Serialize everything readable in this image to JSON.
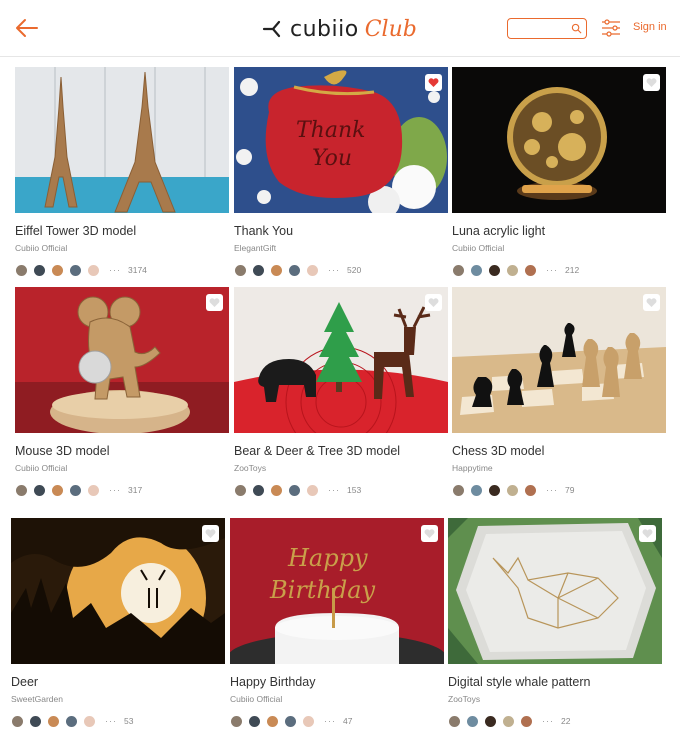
{
  "header": {
    "logo_text": "cubiio",
    "logo_club": "Club",
    "search_placeholder": "",
    "signin_label": "Sign in"
  },
  "colors": {
    "accent": "#ea6a2e"
  },
  "cards": [
    {
      "title": "Eiffel Tower 3D model",
      "author": "Cubiio Official",
      "count": "3174",
      "liked": false
    },
    {
      "title": "Thank You",
      "author": "ElegantGift",
      "count": "520",
      "liked": true
    },
    {
      "title": "Luna acrylic light",
      "author": "Cubiio Official",
      "count": "212",
      "liked": false
    },
    {
      "title": "Mouse 3D model",
      "author": "Cubiio Official",
      "count": "317",
      "liked": false
    },
    {
      "title": "Bear & Deer & Tree 3D model",
      "author": "ZooToys",
      "count": "153",
      "liked": false
    },
    {
      "title": "Chess 3D model",
      "author": "Happytime",
      "count": "79",
      "liked": false
    },
    {
      "title": "Deer",
      "author": "SweetGarden",
      "count": "53",
      "liked": false
    },
    {
      "title": "Happy Birthday",
      "author": "Cubiio Official",
      "count": "47",
      "liked": false
    },
    {
      "title": "Digital style whale pattern",
      "author": "ZooToys",
      "count": "22",
      "liked": false
    }
  ],
  "images": {
    "thank_you_text": "Thank You",
    "birthday_text": "Happy Birthday"
  }
}
